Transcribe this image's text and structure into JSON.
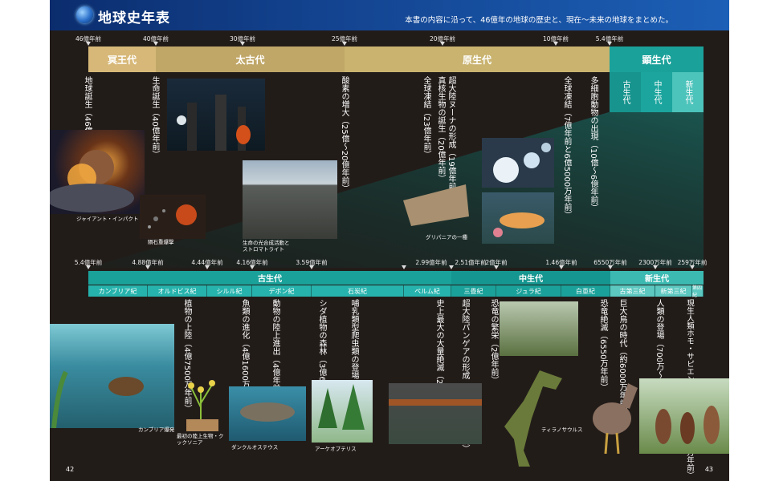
{
  "header": {
    "title": "地球史年表",
    "subtitle": "本書の内容に沿って、46億年の地球の歴史と、現在〜未来の地球をまとめた。"
  },
  "top_scale": [
    "46億年前",
    "40億年前",
    "30億年前",
    "25億年前",
    "20億年前",
    "10億年前",
    "5.4億年前"
  ],
  "eons": [
    {
      "label": "冥王代"
    },
    {
      "label": "太古代"
    },
    {
      "label": "原生代"
    },
    {
      "label": "顕生代"
    }
  ],
  "phanerozoic_eras": [
    "古生代",
    "中生代",
    "新生代"
  ],
  "top_events": [
    "地球誕生（46億年前）",
    "生命誕生（40億年前）",
    "酸素の増大（25億〜20億年前）",
    "全球凍結（23億年前）",
    "超大陸ヌーナの形成（19億年前）",
    "真核生物の誕生（20億年前）",
    "全球凍結（7億年前と6億5000万年前）",
    "多細胞動物の出現（10億〜6億年前）"
  ],
  "top_captions": [
    "ジャイアント・インパクト",
    "隕石重爆撃",
    "生命の光合成活動と\nストロマトライト",
    "グリパニアの一種"
  ],
  "bottom_scale": [
    "5.4億年前",
    "4.88億年前",
    "4.44億年前",
    "4.16億年前",
    "3.59億年前",
    "2.99億年前",
    "2.51億年前",
    "2億年前",
    "1.46億年前",
    "6550万年前",
    "2300万年前",
    "259万年前"
  ],
  "bottom_eras": [
    "古生代",
    "中生代",
    "新生代"
  ],
  "periods": [
    "カンブリア紀",
    "オルドビス紀",
    "シルル紀",
    "デボン紀",
    "石炭紀",
    "ペルム紀",
    "三畳紀",
    "ジュラ紀",
    "白亜紀",
    "古第三紀",
    "新第三紀",
    "第四紀"
  ],
  "bottom_events": [
    "植物の上陸（4億7500万年前）",
    "魚類の進化（4億1600万年前）",
    "動物の陸上進出（4億年前）",
    "シダ植物の森林（3億6000万年前）",
    "哺乳類型爬虫類の登場（石炭紀後期）",
    "超大陸パンゲアの形成（2億5000万年前）",
    "史上最大の大量絶滅（2億5000万年前）",
    "恐竜の繁栄（2億年前）",
    "巨大鳥の時代（約6000万年前）",
    "恐竜絶滅（6550万年前）",
    "人類の登場（700万〜600万年前）",
    "現生人類ホモ・サピエンスが生き残る（約3万年前）"
  ],
  "bottom_captions": [
    "カンブリア爆発",
    "最初の陸上生物・クックソニア",
    "ダンクルオステウス",
    "アーケオプテリス",
    "ティラノサウルス"
  ],
  "page_numbers": {
    "left": "42",
    "right": "43"
  },
  "colors": {
    "background": "#221c19",
    "header": "#13438f",
    "accent_teal": "#1aa19a",
    "gold": "#c9ad63"
  }
}
